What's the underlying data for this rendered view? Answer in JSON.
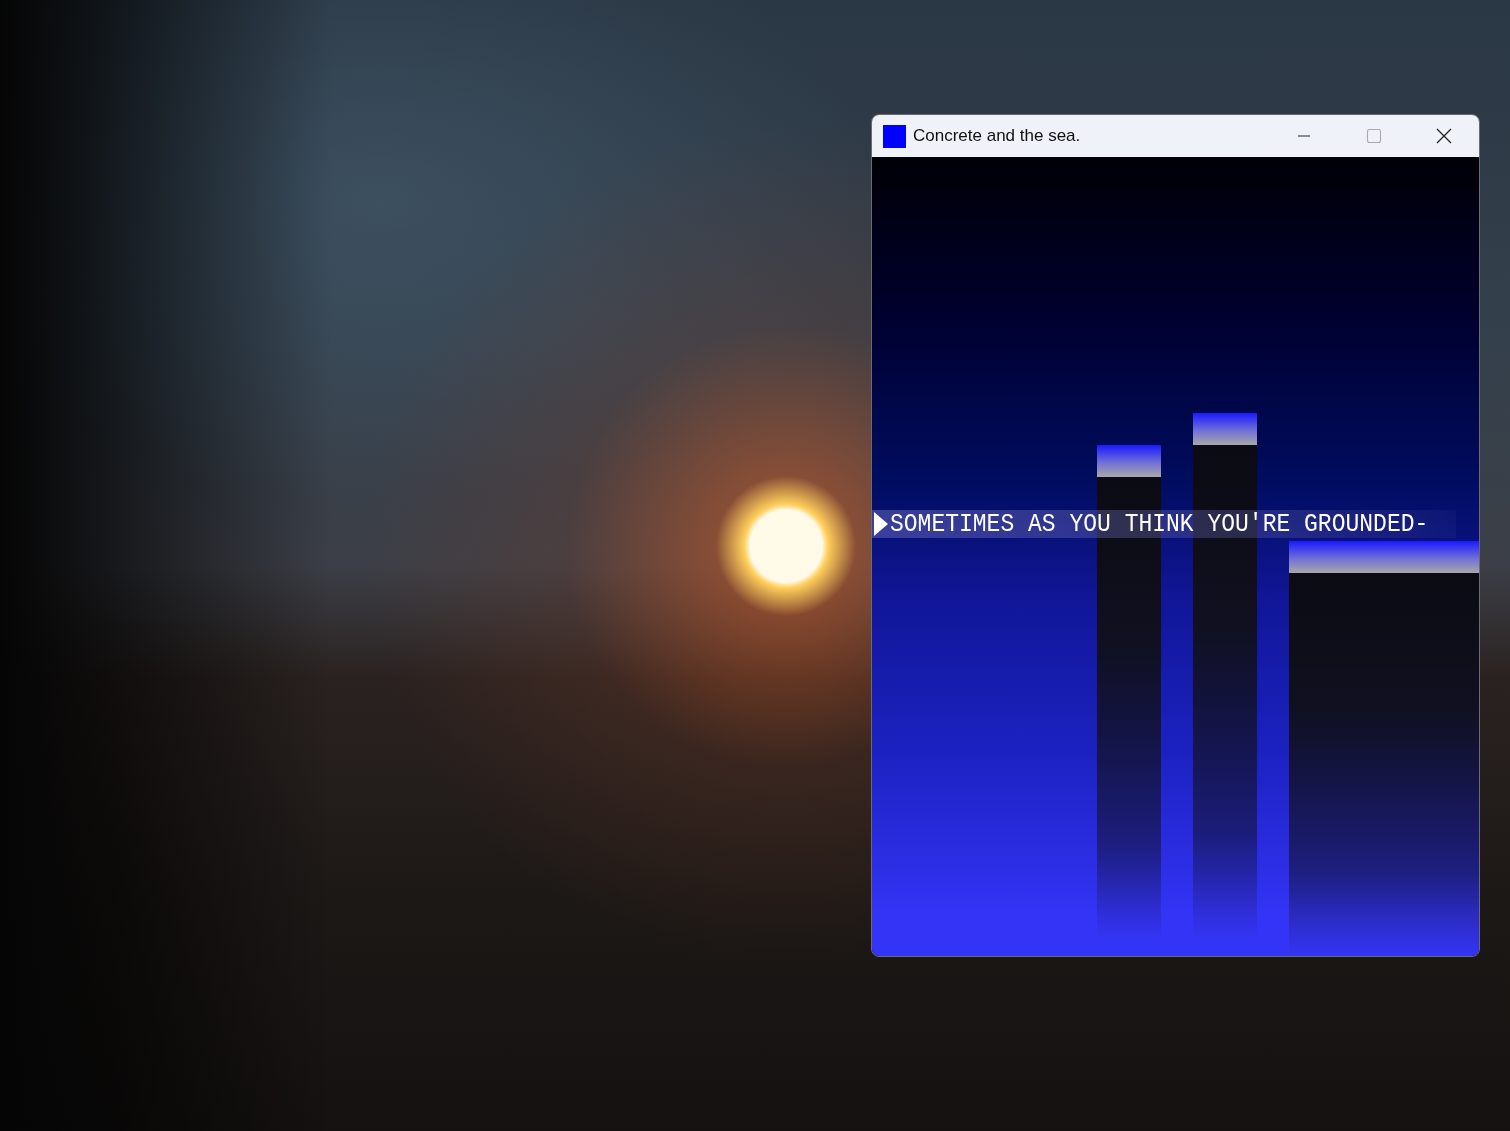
{
  "window": {
    "title": "Concrete and the sea."
  },
  "game": {
    "dialogue": "SOMETIMES AS YOU THINK YOU'RE GROUNDED-"
  }
}
